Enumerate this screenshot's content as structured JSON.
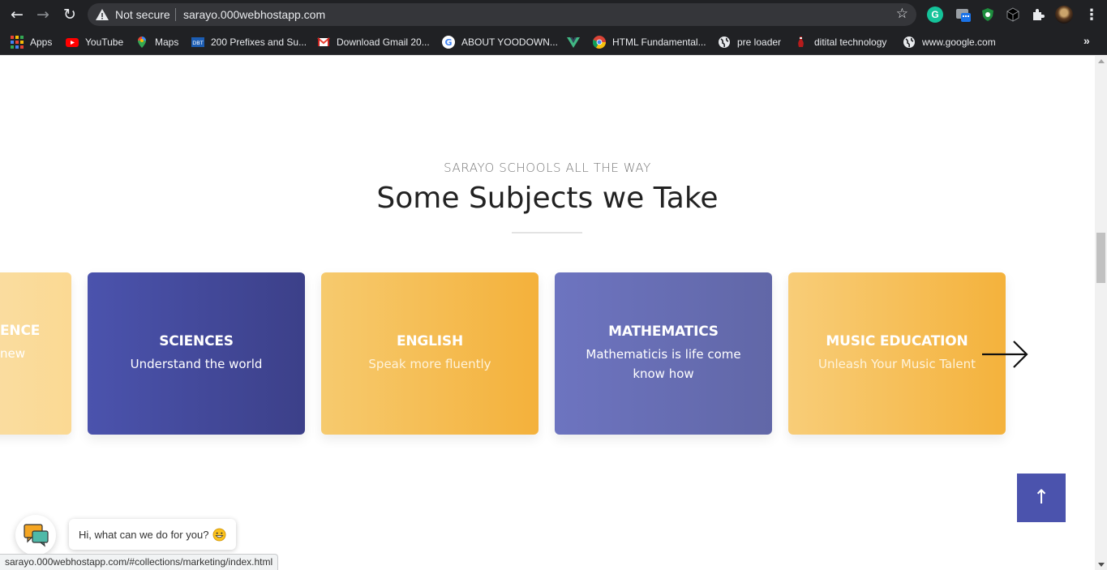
{
  "browser": {
    "security_label": "Not secure",
    "url": "sarayo.000webhostapp.com",
    "bookmarks": [
      {
        "label": "Apps",
        "icon": "apps-grid-icon"
      },
      {
        "label": "YouTube",
        "icon": "youtube-icon"
      },
      {
        "label": "Maps",
        "icon": "maps-pin-icon"
      },
      {
        "label": "200 Prefixes and Su...",
        "icon": "dbt-icon"
      },
      {
        "label": "Download Gmail 20...",
        "icon": "gmail-icon"
      },
      {
        "label": "ABOUT YOODOWN...",
        "icon": "google-icon"
      },
      {
        "label": "",
        "icon": "vuejs-icon"
      },
      {
        "label": "HTML Fundamental...",
        "icon": "chrome-icon"
      },
      {
        "label": "pre loader",
        "icon": "globe-icon"
      },
      {
        "label": "ditital technology",
        "icon": "wine-icon"
      },
      {
        "label": "www.google.com",
        "icon": "globe-icon"
      }
    ],
    "overflow_label": "»",
    "status_url": "sarayo.000webhostapp.com/#collections/marketing/index.html"
  },
  "section": {
    "subtitle": "SARAYO SCHOOLS ALL THE WAY",
    "title": "Some Subjects we Take"
  },
  "cards": {
    "partial": {
      "title": "ENCE",
      "subtitle": "new"
    },
    "sciences": {
      "title": "SCIENCES",
      "subtitle": "Understand the world"
    },
    "english": {
      "title": "ENGLISH",
      "subtitle": "Speak more fluently"
    },
    "math": {
      "title": "MATHEMATICS",
      "subtitle": "Mathematicis is life come know how"
    },
    "music": {
      "title": "MUSIC EDUCATION",
      "subtitle": "Unleash Your Music Talent"
    }
  },
  "back_to_top": "↑",
  "chat": {
    "message": "Hi, what can we do for you?"
  },
  "colors": {
    "primary": "#4b53ad",
    "accent_orange": "#f4b13b",
    "math_purple": "#6d74c0"
  }
}
